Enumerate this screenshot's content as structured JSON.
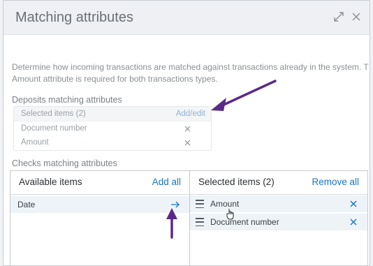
{
  "dialog": {
    "title": "Matching attributes",
    "description_line1": "Determine how incoming transactions are matched against transactions already in the system. T",
    "description_line2": "Amount attribute is required for both transactions types."
  },
  "deposits": {
    "label": "Deposits matching attributes",
    "selected_header": "Selected items (2)",
    "add_edit": "Add/edit",
    "items": [
      "Document number",
      "Amount"
    ]
  },
  "checks": {
    "label": "Checks matching attributes",
    "available": {
      "title": "Available items",
      "action": "Add all",
      "items": [
        "Date"
      ]
    },
    "selected": {
      "title": "Selected items (2)",
      "action": "Remove all",
      "items": [
        "Amount",
        "Document number"
      ]
    }
  },
  "colors": {
    "link": "#1a73c9",
    "annotation_arrow": "#5b2a86",
    "item_background": "#eef3f8"
  },
  "icons": [
    "expand-icon",
    "close-icon",
    "remove-x-icon",
    "move-right-arrow-icon",
    "drag-handle-icon",
    "cursor-hand-icon"
  ]
}
